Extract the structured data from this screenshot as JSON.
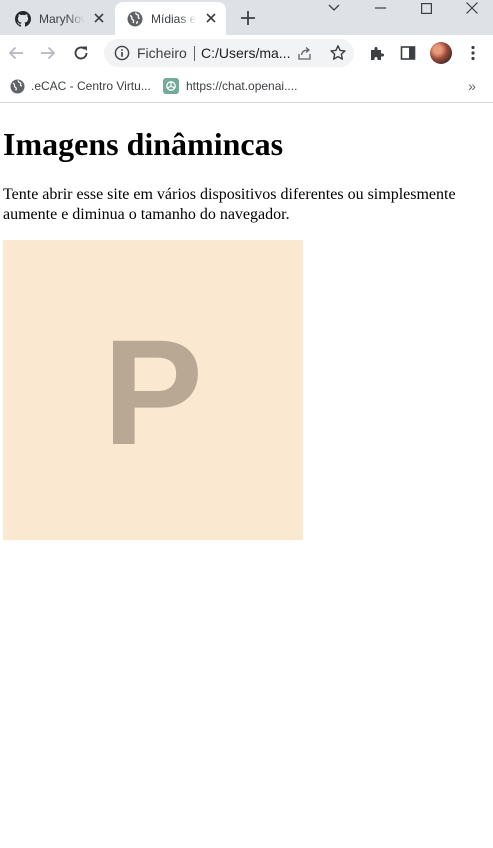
{
  "tabs": [
    {
      "title": "MaryNov",
      "icon": "github-icon",
      "active": false
    },
    {
      "title": "Mídias e",
      "icon": "globe-icon",
      "active": true
    }
  ],
  "toolbar": {
    "scheme": "Ficheiro",
    "url": "C:/Users/ma..."
  },
  "bookmarks": [
    {
      "label": ".eCAC - Centro Virtu...",
      "icon": "globe-icon"
    },
    {
      "label": "https://chat.openai....",
      "icon": "openai-icon"
    }
  ],
  "bookmarks_more": "»",
  "page": {
    "heading": "Imagens dinâmincas",
    "paragraph": "Tente abrir esse site em vários dispositivos diferentes ou simplesmente aumente e diminua o tamanho do navegador.",
    "image_letter": "P"
  },
  "colors": {
    "tabstrip": "#dee1e6",
    "omnibox": "#f1f3f4",
    "placeholder_bg": "#fbe8d0",
    "placeholder_fg": "#b8a894"
  }
}
